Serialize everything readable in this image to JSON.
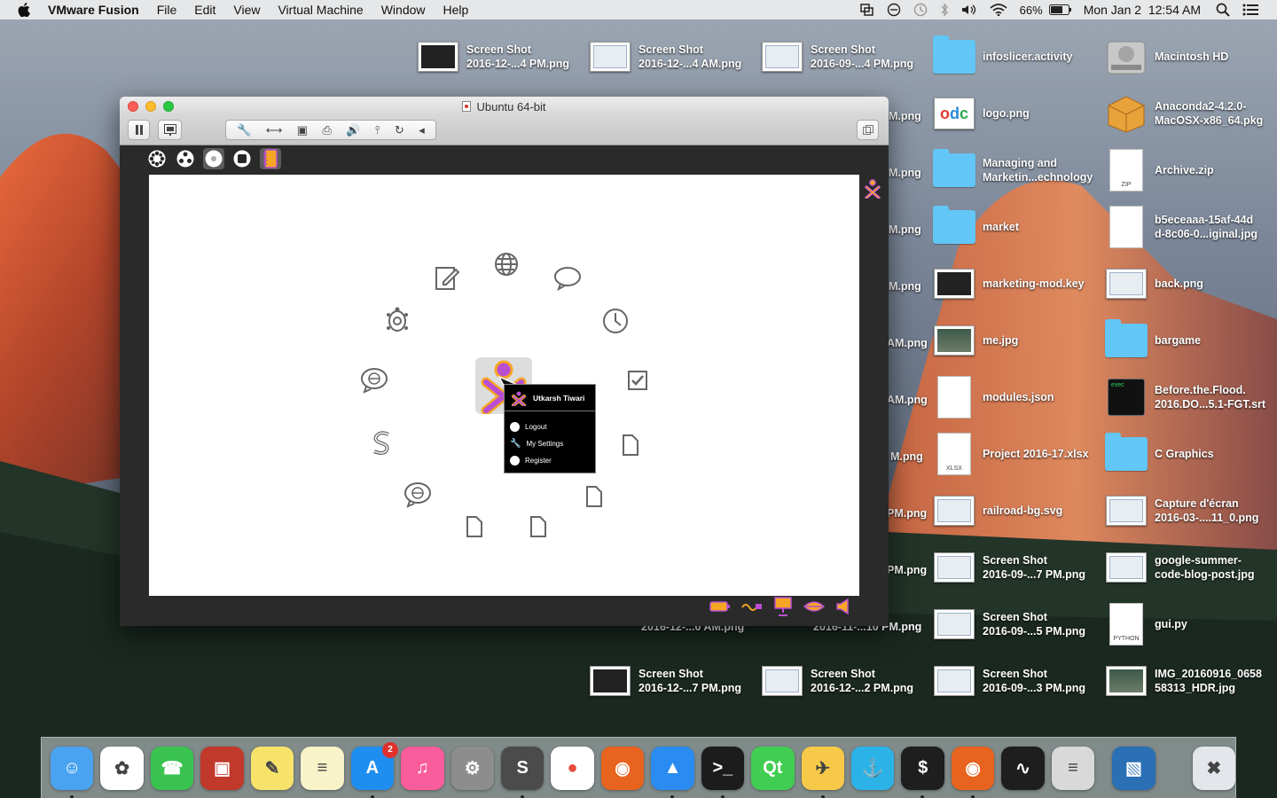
{
  "menubar": {
    "app_name": "VMware Fusion",
    "menus": [
      "File",
      "Edit",
      "View",
      "Virtual Machine",
      "Window",
      "Help"
    ],
    "battery": "66%",
    "datetime": "Mon Jan 2  12:54 AM"
  },
  "desktop": {
    "icons": [
      {
        "label": "Screen Shot\n2016-12-...4 PM.png",
        "kind": "shot-dark"
      },
      {
        "label": "Screen Shot\n2016-12-...4 AM.png",
        "kind": "shot-light"
      },
      {
        "label": "Screen Shot\n2016-09-...4 PM.png",
        "kind": "shot-light"
      },
      {
        "label": "infoslicer.activity",
        "kind": "folder"
      },
      {
        "label": "Macintosh HD",
        "kind": "disk"
      },
      {
        "label": "logo.png",
        "kind": "logo"
      },
      {
        "label": "Anaconda2-4.2.0-\nMacOSX-x86_64.pkg",
        "kind": "pkg"
      },
      {
        "label": "Managing and\nMarketin...echnology",
        "kind": "folder"
      },
      {
        "label": "Archive.zip",
        "kind": "zip"
      },
      {
        "label": "market",
        "kind": "folder"
      },
      {
        "label": "b5eceaaa-15af-44d\nd-8c06-0...iginal.jpg",
        "kind": "doc"
      },
      {
        "label": "marketing-mod.key",
        "kind": "shot-dark"
      },
      {
        "label": "back.png",
        "kind": "shot-light"
      },
      {
        "label": "me.jpg",
        "kind": "photo"
      },
      {
        "label": "bargame",
        "kind": "folder"
      },
      {
        "label": "modules.json",
        "kind": "doc"
      },
      {
        "label": "Before.the.Flood.\n2016.DO...5.1-FGT.srt",
        "kind": "exec"
      },
      {
        "label": "Project 2016-17.xlsx",
        "kind": "xlsx"
      },
      {
        "label": "C Graphics",
        "kind": "folder"
      },
      {
        "label": "railroad-bg.svg",
        "kind": "shot-light"
      },
      {
        "label": "Capture d'écran\n2016-03-....11_0.png",
        "kind": "shot-light"
      },
      {
        "label": "Screen Shot\n2016-09-...7 PM.png",
        "kind": "shot-light"
      },
      {
        "label": "google-summer-\ncode-blog-post.jpg",
        "kind": "shot-light"
      },
      {
        "label": "Screen Shot\n2016-09-...5 PM.png",
        "kind": "shot-light"
      },
      {
        "label": "gui.py",
        "kind": "python"
      },
      {
        "label": "Screen Shot\n2016-12-...7 PM.png",
        "kind": "shot-dark"
      },
      {
        "label": "Screen Shot\n2016-12-...2 PM.png",
        "kind": "shot-light"
      },
      {
        "label": "Screen Shot\n2016-09-...3 PM.png",
        "kind": "shot-light"
      },
      {
        "label": "IMG_20160916_0658\n58313_HDR.jpg",
        "kind": "photo"
      }
    ],
    "partial_labels": [
      "M.png",
      "M.png",
      "M.png",
      "M.png",
      "AM.png",
      "AM.png",
      "M.png",
      "PM.png",
      "PM.png",
      "2016-12-...0 AM.png",
      "2016-11-...10 PM.png"
    ]
  },
  "vm_window": {
    "title": "Ubuntu 64-bit",
    "python_tag": "PYTHON",
    "zip_tag": "ZIP",
    "xlsx_tag": "XLSX",
    "exec_tag": "exec"
  },
  "sugar": {
    "palette_header": "Utkarsh Tiwari",
    "palette_items": [
      "Logout",
      "My Settings",
      "Register"
    ]
  },
  "dock": {
    "apps": [
      "Finder",
      "Photos",
      "FaceTime",
      "Photo Booth",
      "Stickies",
      "Notes",
      "App Store",
      "iTunes",
      "System Preferences",
      "Sublime Text",
      "Chrome",
      "Firefox",
      "Safari",
      "Terminal",
      "Qt Creator",
      "Cyberduck",
      "Transmit",
      "iTerm",
      "Firefox",
      "Activity Monitor",
      "Calculator",
      "VMware Fusion",
      "Trash"
    ],
    "app_store_badge": "2"
  },
  "colors": {
    "menubar_bg": "#ececec",
    "folder": "#62c6f6",
    "sugar_accent": "#b94fd0",
    "sugar_fill": "#f5a623"
  }
}
